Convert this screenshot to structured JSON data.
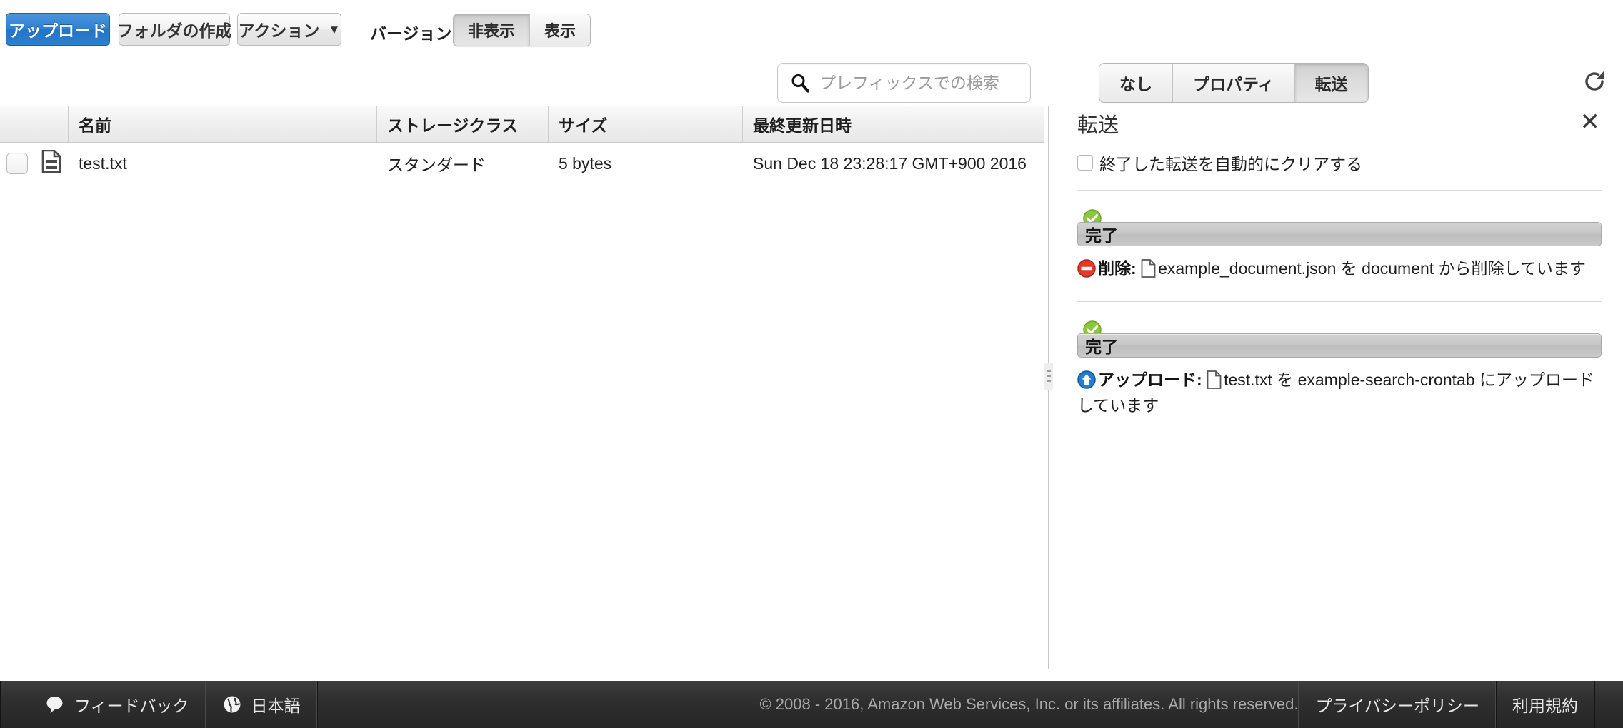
{
  "toolbar": {
    "upload_label": "アップロード",
    "create_folder_label": "フォルダの作成",
    "actions_label": "アクション",
    "actions_caret": "▼",
    "versions_label": "バージョン:",
    "version_options": [
      {
        "label": "非表示",
        "selected": true
      },
      {
        "label": "表示",
        "selected": false
      }
    ],
    "search_placeholder": "プレフィックスでの検索",
    "search_value": "",
    "panel_tabs": [
      {
        "label": "なし",
        "selected": false
      },
      {
        "label": "プロパティ",
        "selected": false
      },
      {
        "label": "転送",
        "selected": true
      }
    ],
    "refresh_icon": "refresh-icon"
  },
  "file_table": {
    "columns": [
      "名前",
      "ストレージクラス",
      "サイズ",
      "最終更新日時"
    ],
    "rows": [
      {
        "name": "test.txt",
        "storage_class": "スタンダード",
        "size": "5 bytes",
        "last_modified": "Sun Dec 18 23:28:17 GMT+900 2016",
        "file_icon": "document-icon"
      }
    ]
  },
  "transfers_panel": {
    "title": "転送",
    "close_icon": "close-icon",
    "auto_clear_label": "終了した転送を自動的にクリアする",
    "auto_clear_checked": false,
    "items": [
      {
        "status_icon": "green-check-icon",
        "status_color": "#8cc63e",
        "progress_label": "完了",
        "progress_percent": 100,
        "op_icon": "delete-forbidden-icon",
        "op_icon_color": "#e03a28",
        "op_label": "削除:",
        "file_icon": "document-icon",
        "detail_text": "example_document.json を document から削除しています"
      },
      {
        "status_icon": "green-check-icon",
        "status_color": "#8cc63e",
        "progress_label": "完了",
        "progress_percent": 100,
        "op_icon": "upload-arrow-icon",
        "op_icon_color": "#1f7fd4",
        "op_label": "アップロード:",
        "file_icon": "document-icon",
        "detail_text": "test.txt を example-search-crontab にアップロードしています"
      }
    ]
  },
  "footer": {
    "feedback_label": "フィードバック",
    "feedback_icon": "speech-bubble-icon",
    "language_label": "日本語",
    "language_icon": "globe-icon",
    "copyright": "© 2008 - 2016, Amazon Web Services, Inc. or its affiliates. All rights reserved.",
    "privacy_label": "プライバシーポリシー",
    "terms_label": "利用規約"
  },
  "colors": {
    "primary_button": "#2f7fd0",
    "success": "#8cc63e",
    "danger": "#e03a28",
    "info": "#1f7fd4",
    "footer_bg": "#2e2e2e"
  }
}
